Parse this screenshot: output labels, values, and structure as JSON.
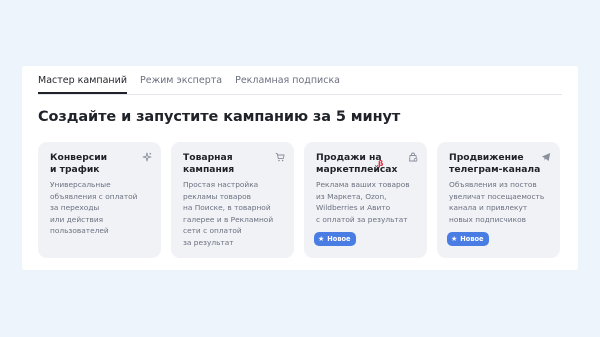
{
  "tabs": [
    {
      "label": "Мастер кампаний",
      "active": true
    },
    {
      "label": "Режим эксперта",
      "active": false
    },
    {
      "label": "Рекламная подписка",
      "active": false
    }
  ],
  "heading": "Создайте и запустите кампанию за 5 минут",
  "cards": [
    {
      "title": "Конверсии\nи трафик",
      "description": "Универсальные\nобъявления с оплатой\nза переходы\nили действия\nпользователей",
      "icon": "sparkle-icon"
    },
    {
      "title": "Товарная\nкампания",
      "description": "Простая настройка\nрекламы товаров\nна Поиске, в товарной\nгалерее и в Рекламной\nсети с оплатой\nза результат",
      "icon": "cart-icon"
    },
    {
      "title": "Продажи на\nмаркетплейсах",
      "beta": "β",
      "description": "Реклама ваших товаров\nиз Маркета, Ozon,\nWildberries и Авито\nс оплатой за результат",
      "badge": "Новое",
      "icon": "shopping-bag-icon"
    },
    {
      "title": "Продвижение\nтелеграм-канала",
      "description": "Объявления из постов\nувеличат посещаемость\nканала и привлекут\nновых подписчиков",
      "badge": "Новое",
      "icon": "telegram-send-icon"
    }
  ],
  "colors": {
    "background": "#eef4fc",
    "card": "#f1f2f6",
    "badge": "#4a7de4",
    "beta": "#e0283c"
  }
}
